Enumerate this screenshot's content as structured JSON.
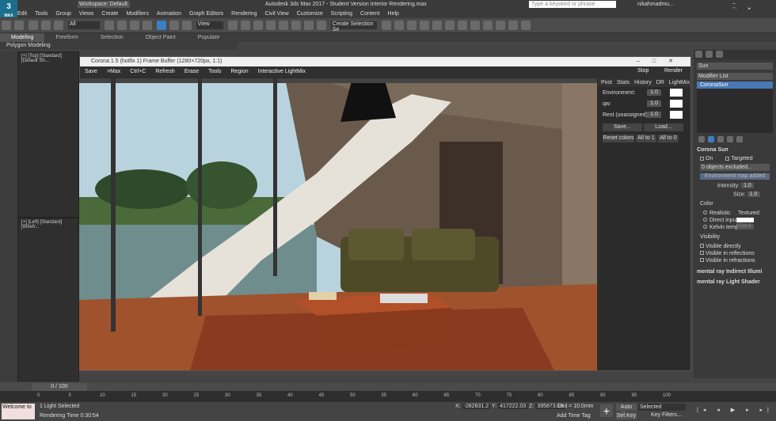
{
  "app": {
    "logo": "3",
    "logo_sub": "MAX",
    "title": "Autodesk 3ds Max 2017 - Student Version    Interior Rendering.max",
    "workspace": "Workspace: Default",
    "search_placeholder": "Type a keyword or phrase",
    "user": "nikahmadmu..."
  },
  "menu": [
    "Edit",
    "Tools",
    "Group",
    "Views",
    "Create",
    "Modifiers",
    "Animation",
    "Graph Editors",
    "Rendering",
    "Civil View",
    "Customize",
    "Scripting",
    "Content",
    "Help"
  ],
  "toolbar": {
    "filter": "All",
    "view": "View",
    "selection_set": "Create Selection Se"
  },
  "ribbon": {
    "tabs": [
      "Modeling",
      "Freeform",
      "Selection",
      "Object Paint",
      "Populate"
    ],
    "sub": "Polygon Modeling"
  },
  "viewports": {
    "top": "[+] [Top] [Standard] [Default Sh...",
    "left": "[+] [Left] [Standard] [Wirefr..."
  },
  "framebuffer": {
    "title": "Corona 1.5 (hotfix 1) Frame Buffer (1280×720px, 1:1)",
    "tools": [
      "Save",
      ">Max",
      "Ctrl+C",
      "Refresh",
      "Erase",
      "Tools",
      "Region",
      "Interactive LightMix"
    ],
    "stop": "Stop",
    "render": "Render",
    "tabs": [
      "Post",
      "Stats",
      "History",
      "DR",
      "LightMix"
    ],
    "rows": [
      {
        "label": "Environment:",
        "value": "1.0"
      },
      {
        "label": "qw:",
        "value": "1.0"
      },
      {
        "label": "Rest (unassigned):",
        "value": "1.0"
      }
    ],
    "save": "Save...",
    "load": "Load...",
    "reset": "Reset colors",
    "all1": "All to 1",
    "all0": "All to 0"
  },
  "cmd": {
    "name": "Sun",
    "modifier_list": "Modifier List",
    "stack_item": "CoronaSun",
    "rollout": "Corona Sun",
    "on": "On",
    "targeted": "Targeted",
    "excluded": "0 objects excluded...",
    "env_added": "Environment map added",
    "intensity_label": "Intensity:",
    "intensity": "1.0",
    "size_label": "Size:",
    "size": "1.0",
    "color_label": "Color",
    "color_opts": [
      "Realistic",
      "Direct input",
      "Kelvin temp"
    ],
    "textured": "Textured",
    "kelvin": "5722.5",
    "visibility_label": "Visibility",
    "vis": [
      "Visible directly",
      "Visible in reflections",
      "Visible in refractions"
    ],
    "r1": "mental ray Indirect Illumi",
    "r2": "mental ray Light Shader"
  },
  "timeline": {
    "frame": "0 / 100",
    "ticks": [
      "0",
      "5",
      "10",
      "15",
      "20",
      "25",
      "30",
      "35",
      "40",
      "45",
      "50",
      "55",
      "60",
      "65",
      "70",
      "75",
      "80",
      "85",
      "90",
      "95",
      "100"
    ]
  },
  "status": {
    "script": "Welcome to",
    "selected": "1 Light Selected",
    "time": "Rendering Time  0:30:54",
    "x": "-282831.2",
    "y": "417222.03",
    "z": "395873.15",
    "grid": "Grid = 10.0mm",
    "autokey": "Auto Key",
    "setkey": "Set Key",
    "selected_dd": "Selected",
    "keyfilters": "Key Filters...",
    "addtime": "Add Time Tag"
  }
}
